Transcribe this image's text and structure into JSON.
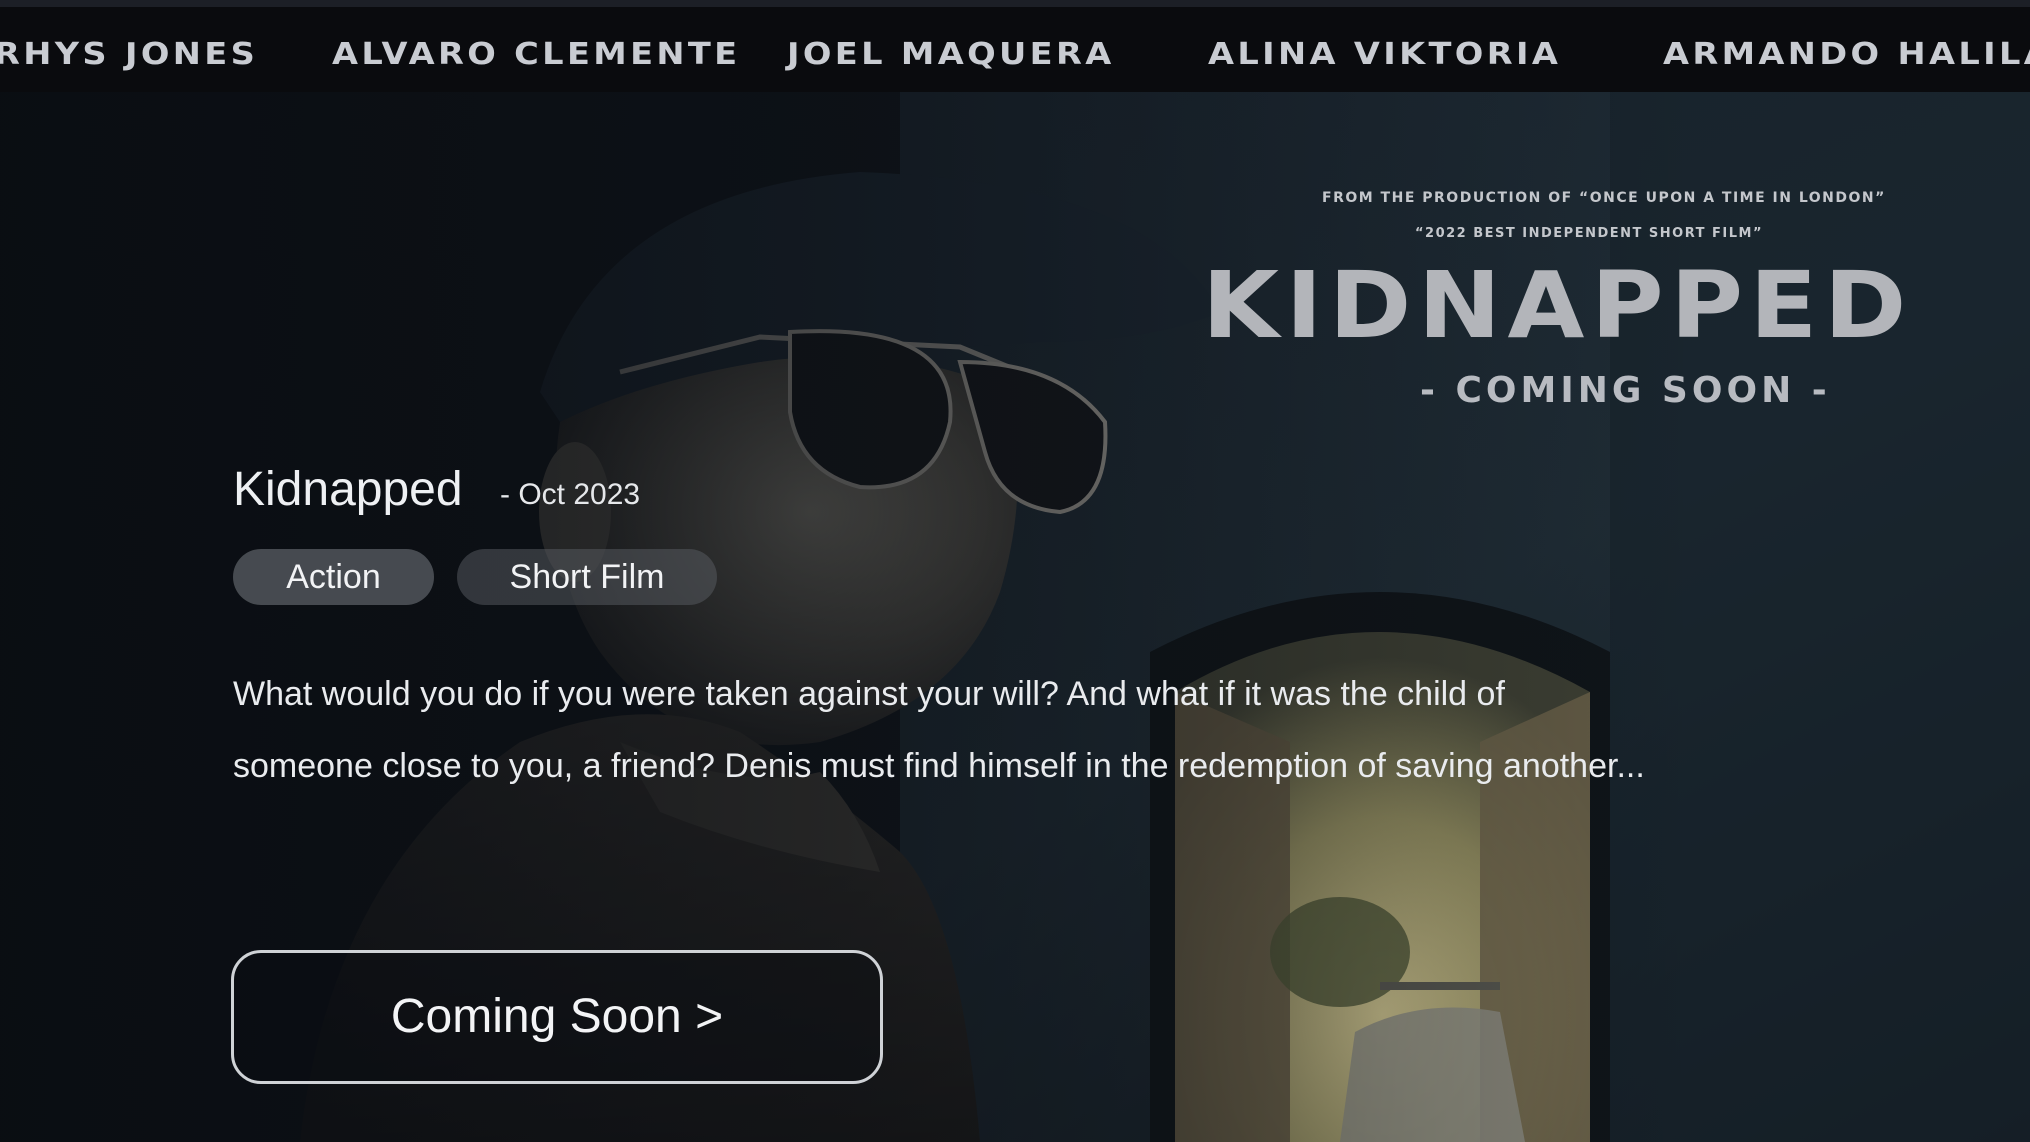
{
  "cast_bar": {
    "names": [
      "Rhys Jones",
      "Alvaro Clemente",
      "Joel Maquera",
      "Alina Viktoria",
      "Armando Halilaj"
    ]
  },
  "poster": {
    "from_line": "From the production of “Once upon a time in London”",
    "award_line": "“2022 Best Independent Short Film”",
    "title": "Kidnapped",
    "coming_line": "- Coming Soon -"
  },
  "movie": {
    "title": "Kidnapped",
    "date": "- Oct 2023",
    "genres": [
      "Action",
      "Short Film"
    ],
    "synopsis": "What would you do if you were taken against your will? And what if it was the child of someone close to you, a friend? Denis must find himself in the redemption of saving another...",
    "cta_label": "Coming Soon >"
  },
  "colors": {
    "background": "#0b0e12",
    "cast_bar": "#0a0b0e",
    "text": "#eef0f3",
    "pill": "#787c82",
    "archway_light": "#b9b07a"
  }
}
